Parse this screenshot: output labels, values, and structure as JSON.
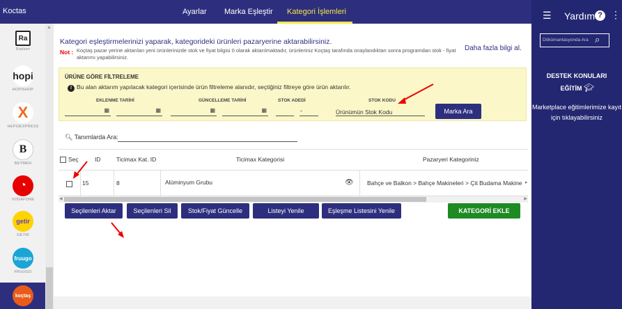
{
  "header": {
    "brand": "Koctas",
    "tabs": [
      {
        "label": "Ayarlar"
      },
      {
        "label": "Marka Eşleştir"
      },
      {
        "label": "Kategori İşlemleri"
      }
    ]
  },
  "marketplaces": [
    {
      "name": "Radium",
      "logo": "Ra",
      "icon": "radium-logo"
    },
    {
      "name": "HOPISHOP",
      "logo": "hopi",
      "icon": "hopi-logo"
    },
    {
      "name": "HEPSIEXPRESS",
      "logo": "X",
      "icon": "hepsiexpress-logo"
    },
    {
      "name": "BEYMEN",
      "logo": "B",
      "icon": "beymen-logo"
    },
    {
      "name": "VODAFONE",
      "logo": "◔",
      "icon": "vodafone-logo"
    },
    {
      "name": "GETIR",
      "logo": "getir",
      "icon": "getir-logo"
    },
    {
      "name": "FRUUGO",
      "logo": "fruugo",
      "icon": "fruugo-logo"
    },
    {
      "name": "",
      "logo": "koçtaş",
      "icon": "koctas-logo"
    }
  ],
  "main": {
    "intro": "Kategori eşleştirmelerinizi yaparak, kategorideki ürünleri pazaryerine aktarabilirsiniz.",
    "not_label": "Not :",
    "not_text": "Koçtaş pazar yerine aktarılan yeni ürünlerinizde stok ve fiyat bilgisi 0 olarak aktarılmaktadır, ürünleriniz Koçtaş tarafında onaylandıktan sonra programdan stok - fiyat aktarımı yapabilirsiniz.",
    "more_link": "Daha fazla bilgi al."
  },
  "filter": {
    "title": "ÜRÜNE GÖRE FİLTRELEME",
    "info": "Bu alan aktarım yapılacak kategori içerisinde ürün filtreleme alanıdır, seçtiğiniz filtreye göre ürün aktarılır.",
    "eklenme_label": "EKLENME TARİHİ",
    "guncelleme_label": "GÜNCELLEME TARİHİ",
    "stok_adedi_label": "STOK ADEDİ",
    "stok_kodu_label": "STOK KODU",
    "stok_kodu_value": "Ürünümün Stok Kodu",
    "range_dash": "-",
    "search_button": "Marka Ara"
  },
  "search": {
    "label": "Tanımlarda Ara:"
  },
  "table": {
    "headers": [
      "Seç",
      "ID",
      "Ticimax Kat. ID",
      "Ticimax Kategorisi",
      "Pazaryeri Kategoriniz"
    ],
    "rows": [
      {
        "id": "15",
        "ticimax_id": "8",
        "ticimax_category": "Alüminyum Grubu",
        "marketplace_category": "Bahçe ve Balkon > Bahçe Makineleri > Çit Budama Makine"
      }
    ]
  },
  "actions": {
    "transfer_selected": "Seçilenleri Aktar",
    "delete_selected": "Seçilenleri Sil",
    "update_stock_price": "Stok/Fiyat Güncelle",
    "refresh_list": "Listeyi Yenile",
    "refresh_match_list": "Eşleşme Listesini Yenile",
    "add_category": "KATEGORİ EKLE"
  },
  "help": {
    "title": "Yardım",
    "search_placeholder": "Dökümantasyonda Ara",
    "topics_title": "DESTEK KONULARI",
    "education": "EĞİTİM",
    "education_note": "Marketplace eğitimlerimize kayıt için tıklayabilirsiniz"
  },
  "colors": {
    "navy": "#2d2f7e",
    "accent_yellow": "#f5e642",
    "filter_bg": "#fbf7c8",
    "green": "#1e8a23",
    "red": "#e00000"
  }
}
